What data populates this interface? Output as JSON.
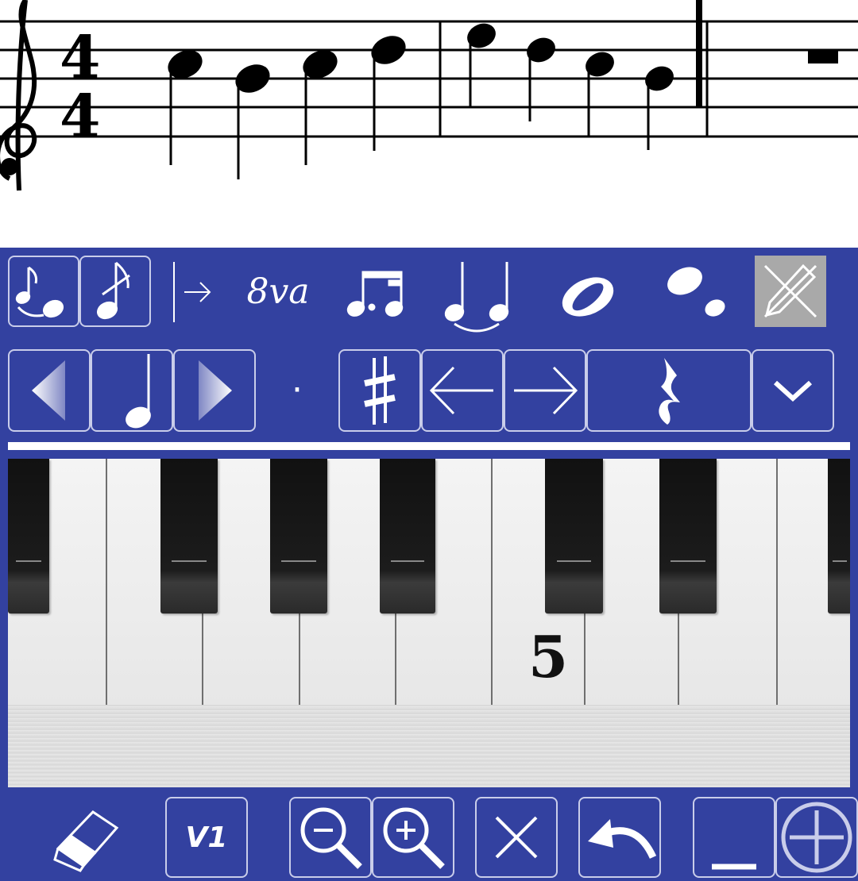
{
  "score": {
    "time_signature": {
      "top": "4",
      "bottom": "4"
    },
    "clef": "treble-clef"
  },
  "toolbar_row1": {
    "items": [
      "grace-note-icon",
      "eighth-note-icon",
      "slide-arrow-icon",
      "ottava-icon",
      "beam-icon",
      "tie-icon",
      "whole-note-icon",
      "staccato-icon",
      "pencil-icon"
    ],
    "ottava_label": "8va",
    "selected": "pencil-icon"
  },
  "toolbar_row2": {
    "dot_symbol": "·",
    "items": [
      "prev-duration-button",
      "quarter-note-button",
      "next-duration-button",
      "dot-button",
      "sharp-button",
      "move-left-button",
      "move-right-button",
      "rest-button",
      "dropdown-button"
    ]
  },
  "piano": {
    "octave_label": "5"
  },
  "bottom_bar": {
    "voice_label": "V1",
    "items": [
      "eraser-button",
      "voice-button",
      "zoom-out-button",
      "zoom-in-button",
      "delete-button",
      "undo-button",
      "minus-button",
      "plus-button"
    ]
  },
  "colors": {
    "panel": "#3341a0",
    "button_border": "#c9cdea",
    "selected": "#a9a9a9"
  }
}
